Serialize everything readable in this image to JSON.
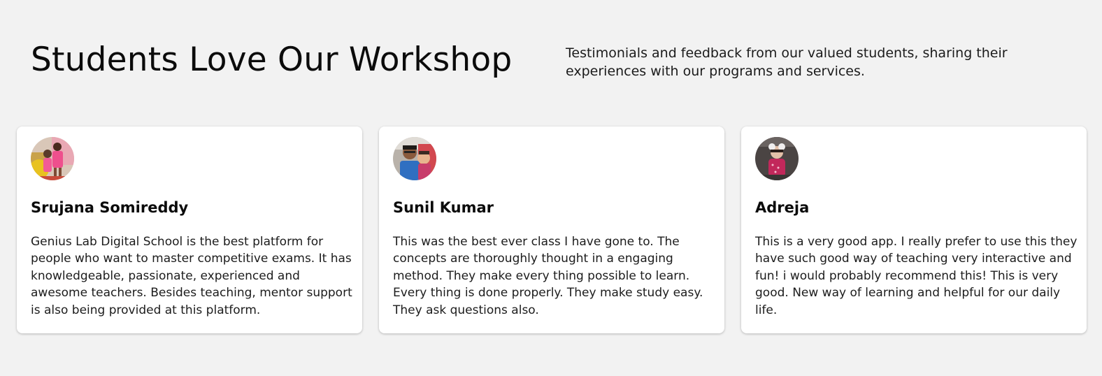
{
  "header": {
    "title": "Students Love Our Workshop",
    "subtitle": "Testimonials and feedback from our valued students, sharing their experiences with our programs and services."
  },
  "testimonials": [
    {
      "name": "Srujana Somireddy",
      "quote": "Genius Lab Digital School is the best platform for people who want to master competitive exams. It has knowledgeable, passionate, experienced and awesome teachers. Besides teaching, mentor support is also being provided at this platform."
    },
    {
      "name": "Sunil Kumar",
      "quote": "This was the best ever class I have gone to. The concepts are thoroughly thought in a engaging method. They make every thing possible to learn. Every thing is done properly. They make study easy. They ask questions also."
    },
    {
      "name": "Adreja",
      "quote": "This is a very good app. I really prefer to use this they have such good way of teaching very interactive and fun! i would probably recommend this! This is very good. New way of learning and helpful for our daily life."
    }
  ],
  "colors": {
    "background": "#f2f2f2",
    "card": "#ffffff",
    "text": "#111111"
  }
}
